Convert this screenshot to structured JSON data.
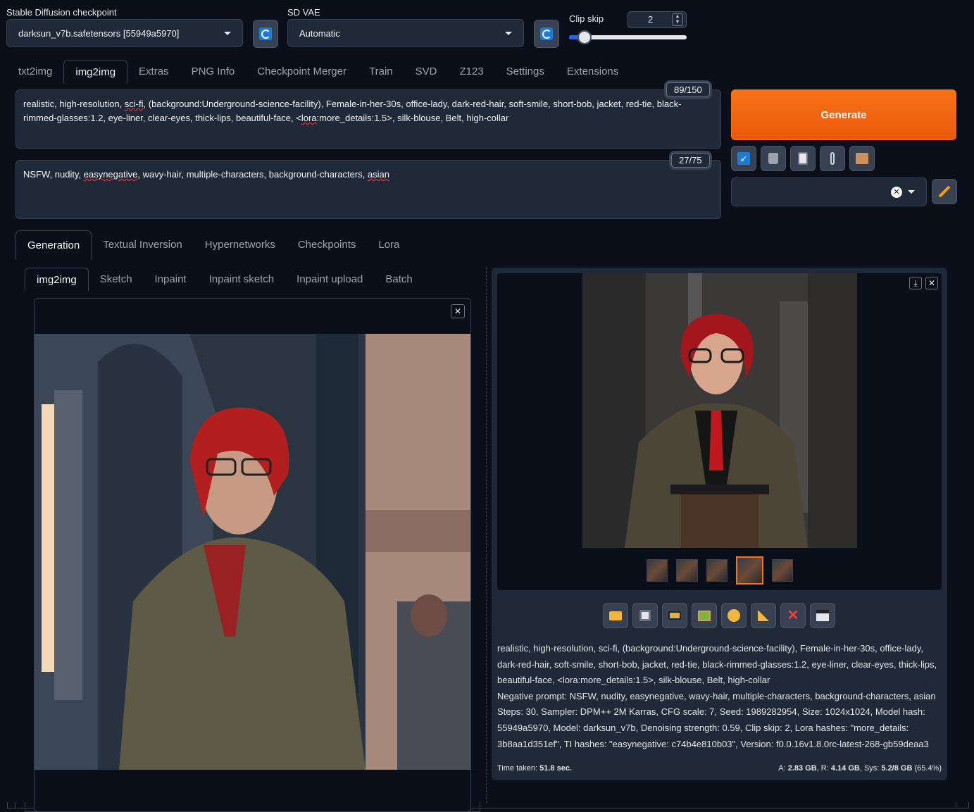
{
  "top": {
    "checkpoint_label": "Stable Diffusion checkpoint",
    "checkpoint_value": "darksun_v7b.safetensors [55949a5970]",
    "vae_label": "SD VAE",
    "vae_value": "Automatic",
    "clip_label": "Clip skip",
    "clip_value": "2",
    "clip_slider_fraction": 0.13
  },
  "main_tabs": [
    "txt2img",
    "img2img",
    "Extras",
    "PNG Info",
    "Checkpoint Merger",
    "Train",
    "SVD",
    "Z123",
    "Settings",
    "Extensions"
  ],
  "prompt": {
    "counter": "89/150",
    "text_parts": [
      "realistic, high-resolution, ",
      "sci-fi",
      ", (background:Underground-science-facility), Female-in-her-30s, office-lady, dark-red-hair, soft-smile, short-bob, jacket, red-tie, black-rimmed-glasses:1.2, eye-liner, clear-eyes, thick-lips, beautiful-face, <",
      "lora",
      ":more_details:1.5>, silk-blouse, Belt, high-collar"
    ]
  },
  "negative": {
    "counter": "27/75",
    "text_parts": [
      "NSFW, nudity,  ",
      "easynegative",
      ", wavy-hair, multiple-characters, background-characters, ",
      "asian"
    ]
  },
  "generate_label": "Generate",
  "sub_tabs": [
    "Generation",
    "Textual Inversion",
    "Hypernetworks",
    "Checkpoints",
    "Lora"
  ],
  "img_tabs": [
    "img2img",
    "Sketch",
    "Inpaint",
    "Inpaint sketch",
    "Inpaint upload",
    "Batch"
  ],
  "output": {
    "info_lines": [
      "realistic, high-resolution, sci-fi, (background:Underground-science-facility), Female-in-her-30s, office-lady, dark-red-hair, soft-smile, short-bob, jacket, red-tie, black-rimmed-glasses:1.2, eye-liner, clear-eyes, thick-lips, beautiful-face, <lora:more_details:1.5>, silk-blouse, Belt, high-collar",
      "Negative prompt: NSFW, nudity, easynegative, wavy-hair, multiple-characters, background-characters, asian",
      "Steps: 30, Sampler: DPM++ 2M Karras, CFG scale: 7, Seed: 1989282954, Size: 1024x1024, Model hash: 55949a5970, Model: darksun_v7b, Denoising strength: 0.59, Clip skip: 2, Lora hashes: \"more_details: 3b8aa1d351ef\", TI hashes: \"easynegative: c74b4e810b03\", Version: f0.0.16v1.8.0rc-latest-268-gb59deaa3"
    ],
    "time_label": "Time taken: ",
    "time_value": "51.8 sec.",
    "mem_a_label": "A: ",
    "mem_a": "2.83 GB",
    "mem_r_label": ", R: ",
    "mem_r": "4.14 GB",
    "mem_sys_label": ", Sys: ",
    "mem_sys": "5.2/8 GB",
    "mem_pct": " (65.4%)"
  },
  "colors": {
    "accent": "#f97316",
    "bg": "#0b0f19",
    "panel": "#1f2937",
    "border": "#374151"
  }
}
